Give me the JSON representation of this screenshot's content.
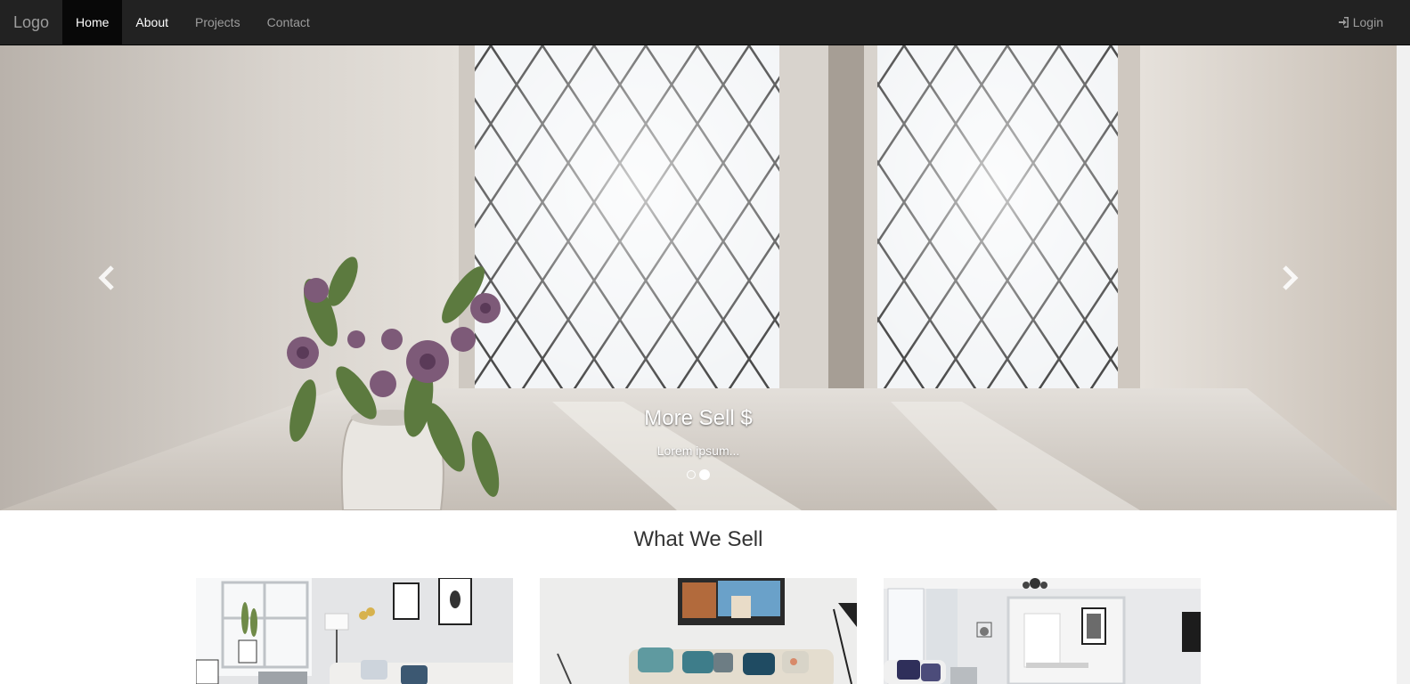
{
  "navbar": {
    "brand": "Logo",
    "items": [
      {
        "label": "Home"
      },
      {
        "label": "About"
      },
      {
        "label": "Projects"
      },
      {
        "label": "Contact"
      }
    ],
    "login_label": "Login"
  },
  "carousel": {
    "caption_title": "More Sell $",
    "caption_text": "Lorem ipsum...",
    "slide_count": 2,
    "active_slide": 2
  },
  "section": {
    "title": "What We Sell"
  },
  "colors": {
    "navbar_bg": "#222222",
    "nav_active_bg": "#080808",
    "nav_text": "#9d9d9d"
  },
  "icons": {
    "login": "log-in-icon",
    "prev": "chevron-left-icon",
    "next": "chevron-right-icon"
  }
}
